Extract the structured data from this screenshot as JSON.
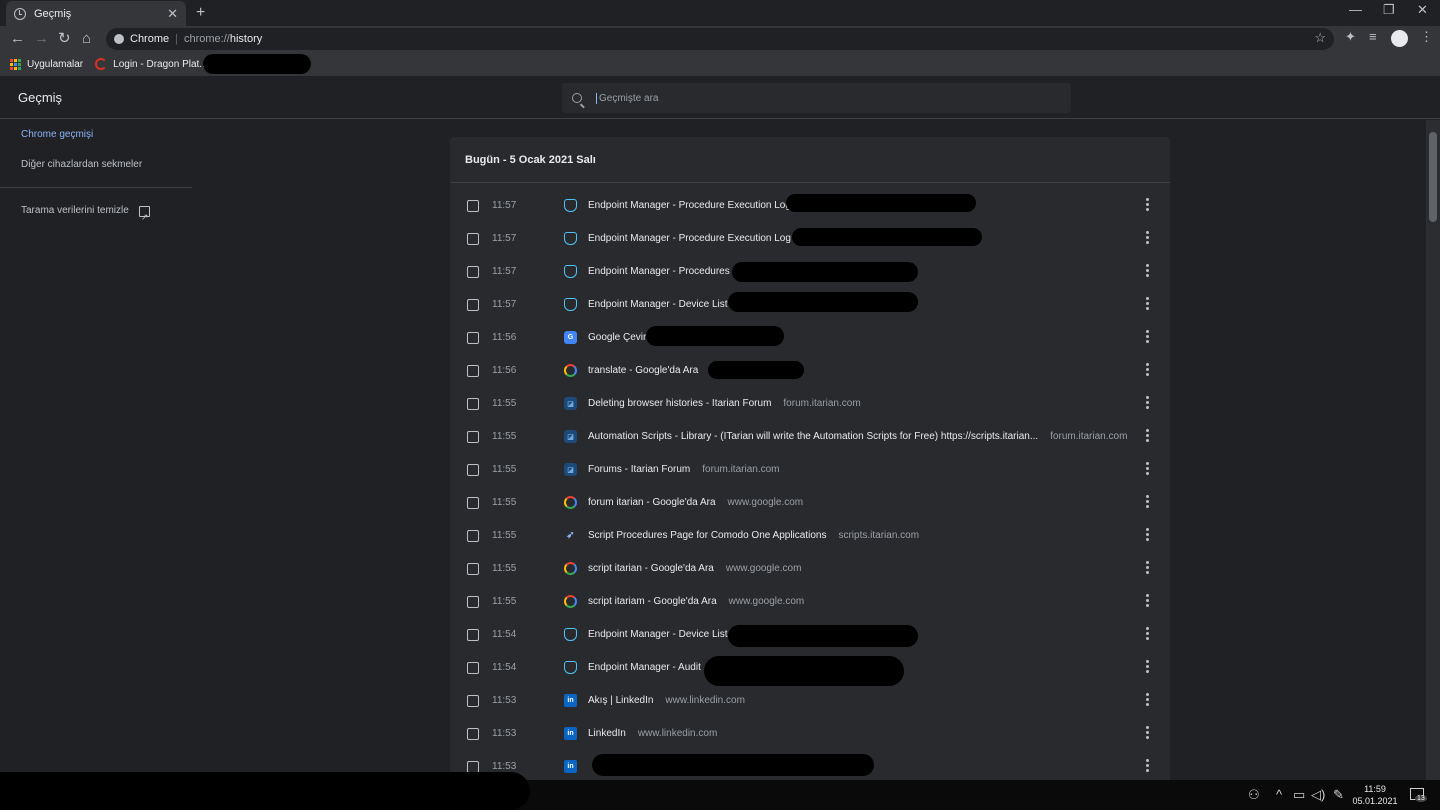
{
  "tab": {
    "title": "Geçmiş",
    "close": "✕",
    "new": "+"
  },
  "window_controls": {
    "minimize": "—",
    "restore": "❐",
    "close": "✕"
  },
  "toolbar": {
    "back": "←",
    "forward": "→",
    "reload": "↻",
    "home": "⌂",
    "omnibox_chip": "Chrome",
    "omnibox_sep": "|",
    "omnibox_scheme": "chrome://",
    "omnibox_path": "history",
    "star": "☆",
    "extensions": "✦",
    "media": "≡",
    "menu": "⋮"
  },
  "bookmarks": [
    {
      "label": "Uygulamalar",
      "icon": "apps-grid-icon"
    },
    {
      "label": "Login - Dragon Plat...",
      "icon": "dragon-logo-icon"
    }
  ],
  "header": {
    "title": "Geçmiş",
    "search_placeholder": "Geçmişte ara"
  },
  "sidebar": {
    "items": [
      {
        "label": "Chrome geçmişi",
        "active": true
      },
      {
        "label": "Diğer cihazlardan sekmeler",
        "active": false
      }
    ],
    "clear_label": "Tarama verilerini temizle"
  },
  "history": {
    "date_heading": "Bugün - 5 Ocak 2021 Salı",
    "entries": [
      {
        "time": "11:57",
        "title": "Endpoint Manager - Procedure Execution Log",
        "domain": "",
        "icon": "shield"
      },
      {
        "time": "11:57",
        "title": "Endpoint Manager - Procedure Execution Log",
        "domain": "",
        "icon": "shield"
      },
      {
        "time": "11:57",
        "title": "Endpoint Manager - Procedures",
        "domain": "",
        "icon": "shield"
      },
      {
        "time": "11:57",
        "title": "Endpoint Manager - Device List",
        "domain": "",
        "icon": "shield"
      },
      {
        "time": "11:56",
        "title": "Google Çevir",
        "domain": "",
        "icon": "translate"
      },
      {
        "time": "11:56",
        "title": "translate - Google'da Ara",
        "domain": "",
        "icon": "google"
      },
      {
        "time": "11:55",
        "title": "Deleting browser histories - Itarian Forum",
        "domain": "forum.itarian.com",
        "icon": "itarian"
      },
      {
        "time": "11:55",
        "title": "Automation Scripts - Library - (ITarian will write the Automation Scripts for Free) https://scripts.itarian...",
        "domain": "forum.itarian.com",
        "icon": "itarian"
      },
      {
        "time": "11:55",
        "title": "Forums - Itarian Forum",
        "domain": "forum.itarian.com",
        "icon": "itarian"
      },
      {
        "time": "11:55",
        "title": "forum itarian - Google'da Ara",
        "domain": "www.google.com",
        "icon": "google"
      },
      {
        "time": "11:55",
        "title": "Script Procedures Page for Comodo One Applications",
        "domain": "scripts.itarian.com",
        "icon": "script"
      },
      {
        "time": "11:55",
        "title": "script itarian - Google'da Ara",
        "domain": "www.google.com",
        "icon": "google"
      },
      {
        "time": "11:55",
        "title": "script itariam - Google'da Ara",
        "domain": "www.google.com",
        "icon": "google"
      },
      {
        "time": "11:54",
        "title": "Endpoint Manager - Device List",
        "domain": "",
        "icon": "shield"
      },
      {
        "time": "11:54",
        "title": "Endpoint Manager - Audit",
        "domain": "",
        "icon": "shield"
      },
      {
        "time": "11:53",
        "title": "Akış | LinkedIn",
        "domain": "www.linkedin.com",
        "icon": "linkedin"
      },
      {
        "time": "11:53",
        "title": "LinkedIn",
        "domain": "www.linkedin.com",
        "icon": "linkedin"
      },
      {
        "time": "11:53",
        "title": "",
        "domain": "",
        "icon": "linkedin"
      }
    ]
  },
  "taskbar": {
    "time": "11:59",
    "date": "05.01.2021",
    "notifications": "13",
    "tray_icons": [
      "people-icon",
      "chevron-up-icon",
      "network-icon",
      "volume-icon",
      "pen-icon"
    ]
  },
  "colors": {
    "background": "#202124",
    "card": "#292a2d",
    "accent": "#8ab4f8",
    "text": "#e8eaed",
    "muted": "#9aa0a6"
  }
}
